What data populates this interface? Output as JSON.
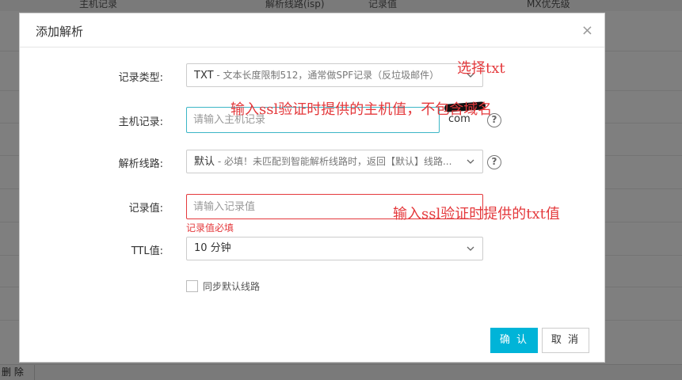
{
  "background": {
    "columns": [
      "主机记录",
      "解析线路(isp)",
      "记录值",
      "MX优先级"
    ],
    "footer_delete": "删 除"
  },
  "dialog": {
    "title": "添加解析",
    "close_symbol": "×",
    "record_type": {
      "label": "记录类型:",
      "value": "TXT",
      "value_hint": " - 文本长度限制512，通常做SPF记录（反垃圾邮件）"
    },
    "host_record": {
      "label": "主机记录:",
      "placeholder": "请输入主机记录",
      "suffix": "com"
    },
    "line": {
      "label": "解析线路:",
      "value": "默认",
      "value_hint": " - 必填！未匹配到智能解析线路时，返回【默认】线路..."
    },
    "record_value": {
      "label": "记录值:",
      "placeholder": "请输入记录值",
      "error": "记录值必填"
    },
    "ttl": {
      "label": "TTL值:",
      "value": "10 分钟"
    },
    "sync_default": {
      "label": "同步默认线路",
      "checked": false
    },
    "buttons": {
      "confirm": "确 认",
      "cancel": "取 消"
    }
  },
  "annotations": {
    "select_txt": "选择txt",
    "host_hint": "输入ssl验证时提供的主机值，不包含域名",
    "value_hint": "输入ssl验证时提供的txt值"
  },
  "colors": {
    "primary": "#00b4d8",
    "error": "#e4393c",
    "focus": "#3cb6c6"
  }
}
